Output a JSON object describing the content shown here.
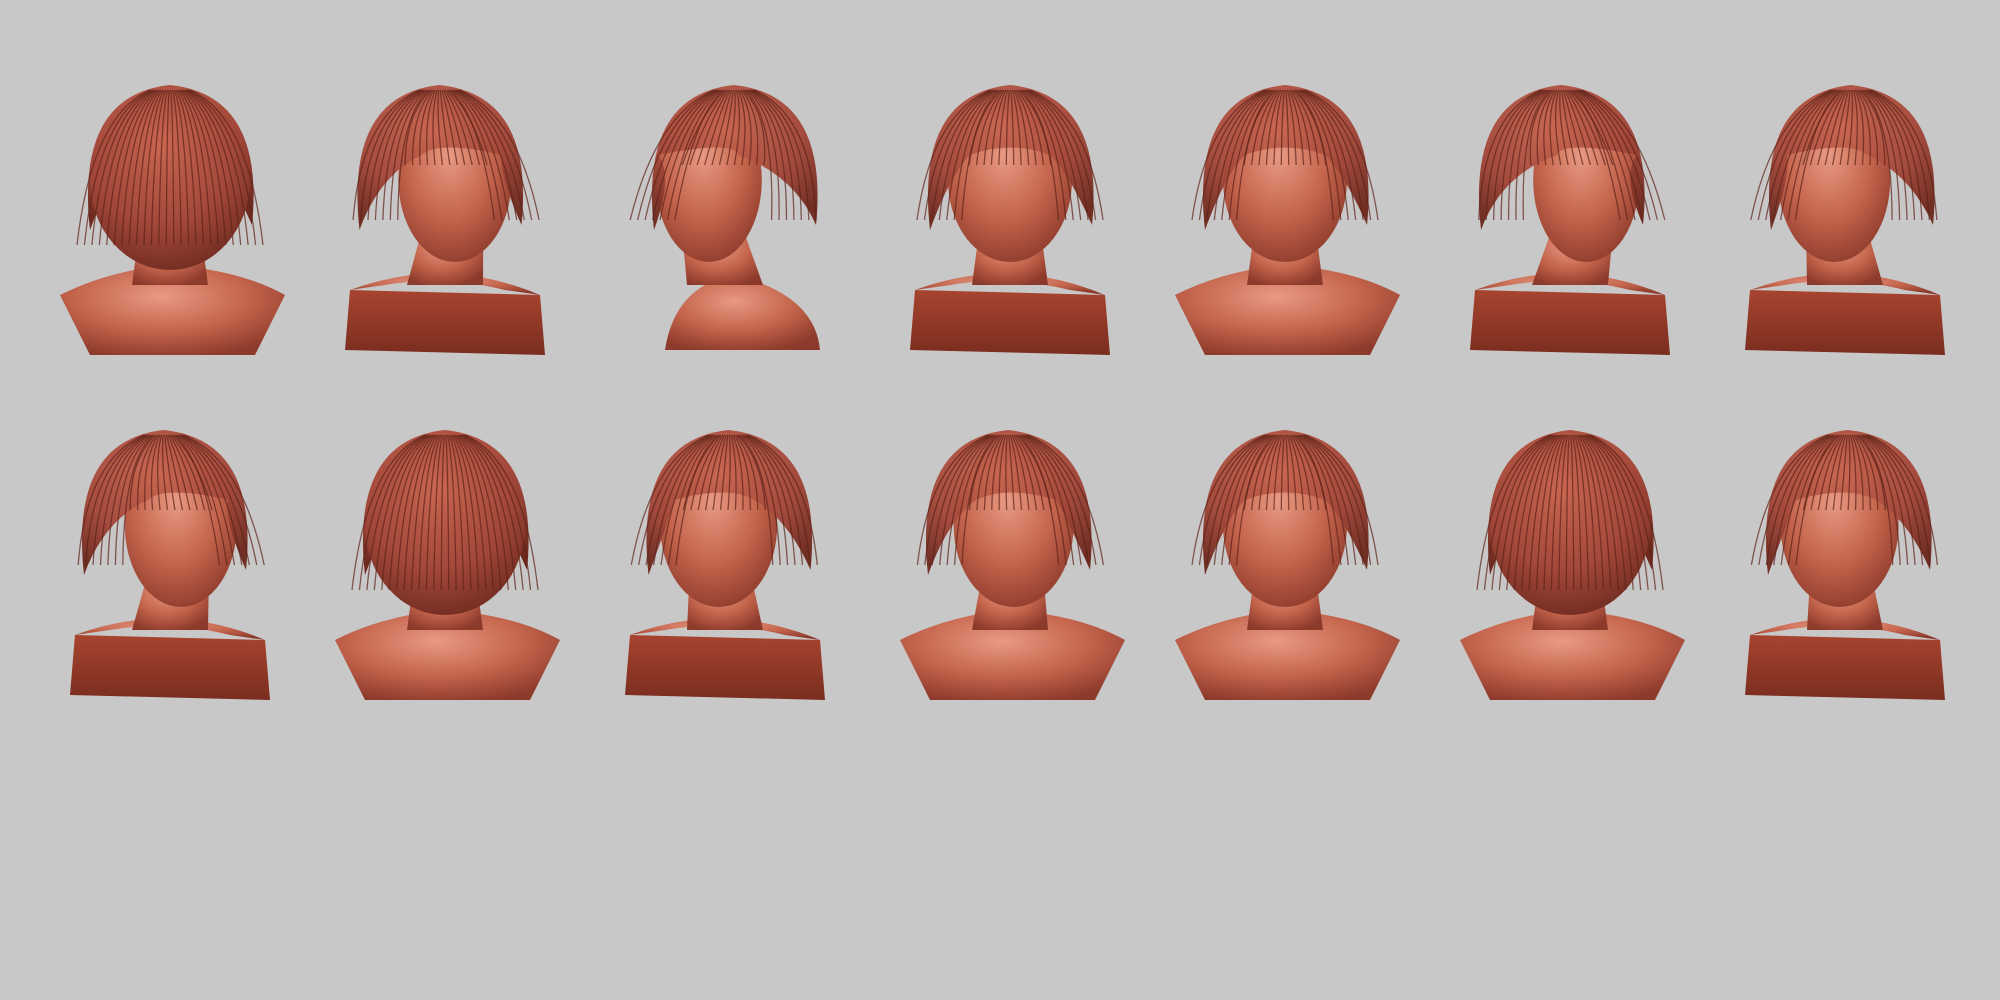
{
  "scene": {
    "background": "#c8c8c8",
    "material_color": "#b2523f",
    "highlight_color": "#e6957e",
    "shadow_color": "#6e2a1f",
    "grid": {
      "rows": 2,
      "columns": 7
    }
  },
  "rows": [
    {
      "views": [
        {
          "view": "back",
          "facing": 0,
          "base": "shoulders"
        },
        {
          "view": "three-quarter-right",
          "facing": 0.55,
          "base": "cut"
        },
        {
          "view": "profile-left",
          "facing": -0.9,
          "base": "narrow"
        },
        {
          "view": "front-up",
          "facing": 0,
          "base": "cut"
        },
        {
          "view": "front",
          "facing": 0,
          "base": "shoulders"
        },
        {
          "view": "profile-right",
          "facing": 0.9,
          "base": "cut"
        },
        {
          "view": "up-left",
          "facing": -0.6,
          "base": "cut"
        }
      ]
    },
    {
      "views": [
        {
          "view": "three-quarter-right",
          "facing": 0.6,
          "base": "cut"
        },
        {
          "view": "back-tilted",
          "facing": 0,
          "base": "shoulders"
        },
        {
          "view": "three-quarter-left",
          "facing": -0.35,
          "base": "cut"
        },
        {
          "view": "front-down-right",
          "facing": 0.2,
          "base": "shoulders"
        },
        {
          "view": "front",
          "facing": 0,
          "base": "shoulders"
        },
        {
          "view": "top-down",
          "facing": 0,
          "base": "shoulders"
        },
        {
          "view": "three-quarter-left",
          "facing": -0.3,
          "base": "cut"
        }
      ]
    }
  ]
}
